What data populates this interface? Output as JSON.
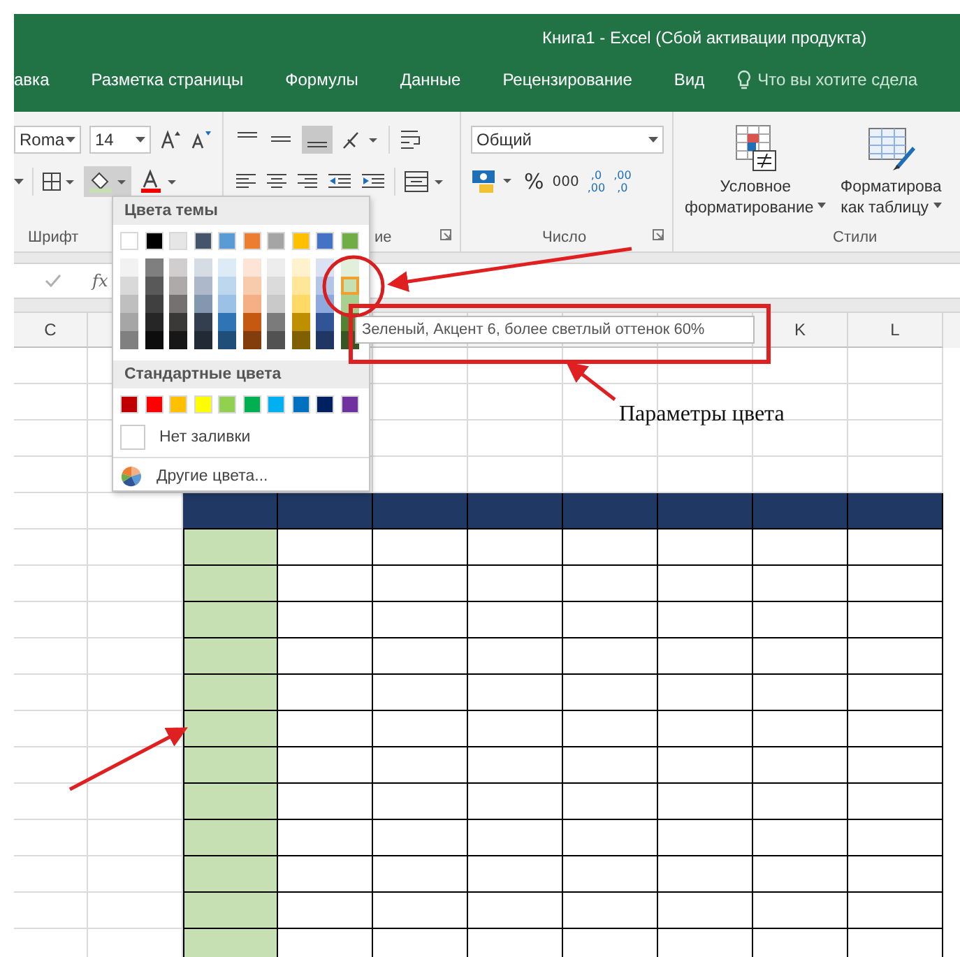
{
  "window": {
    "title": "Книга1 - Excel (Сбой активации продукта)"
  },
  "tabs": [
    {
      "label": "авка",
      "selected": false
    },
    {
      "label": "Разметка страницы",
      "selected": false
    },
    {
      "label": "Формулы",
      "selected": false
    },
    {
      "label": "Данные",
      "selected": false
    },
    {
      "label": "Рецензирование",
      "selected": false
    },
    {
      "label": "Вид",
      "selected": false
    }
  ],
  "tell_me": {
    "placeholder": "Что вы хотите сдела"
  },
  "ribbon": {
    "font_name": "Roma",
    "font_size": "14",
    "number_format": "Общий",
    "percent": "%",
    "thousands": "000",
    "increase_decimal": {
      "top": ",0",
      "bottom": ",00"
    },
    "decrease_decimal": {
      "top": ",00",
      "bottom": ",0"
    },
    "conditional_formatting": [
      "Условное",
      "форматирование"
    ],
    "format_as_table": [
      "Форматирова",
      "как таблицу"
    ],
    "group_labels": [
      "Шрифт",
      "ие",
      "Число",
      "Стили"
    ]
  },
  "formula_bar": {
    "fx": "fx"
  },
  "column_headers": [
    "C",
    "K",
    "L"
  ],
  "color_menu": {
    "theme_title": "Цвета темы",
    "theme_colors": [
      {
        "color": "#ffffff",
        "shades": [
          {
            "color": "#f2f2f2",
            "selected": false
          },
          {
            "color": "#d9d9d9",
            "selected": false
          },
          {
            "color": "#bfbfbf",
            "selected": false
          },
          {
            "color": "#a6a6a6",
            "selected": false
          },
          {
            "color": "#808080",
            "selected": false
          }
        ]
      },
      {
        "color": "#000000",
        "shades": [
          {
            "color": "#7f7f7f",
            "selected": false
          },
          {
            "color": "#595959",
            "selected": false
          },
          {
            "color": "#404040",
            "selected": false
          },
          {
            "color": "#262626",
            "selected": false
          },
          {
            "color": "#0d0d0d",
            "selected": false
          }
        ]
      },
      {
        "color": "#e7e6e6",
        "shades": [
          {
            "color": "#d0cece",
            "selected": false
          },
          {
            "color": "#aeaaaa",
            "selected": false
          },
          {
            "color": "#767171",
            "selected": false
          },
          {
            "color": "#3b3838",
            "selected": false
          },
          {
            "color": "#181717",
            "selected": false
          }
        ]
      },
      {
        "color": "#44546a",
        "shades": [
          {
            "color": "#d6dce4",
            "selected": false
          },
          {
            "color": "#adb9ca",
            "selected": false
          },
          {
            "color": "#8497b0",
            "selected": false
          },
          {
            "color": "#333f4f",
            "selected": false
          },
          {
            "color": "#222a35",
            "selected": false
          }
        ]
      },
      {
        "color": "#5b9bd5",
        "shades": [
          {
            "color": "#ddebf7",
            "selected": false
          },
          {
            "color": "#bdd7ee",
            "selected": false
          },
          {
            "color": "#9bc2e6",
            "selected": false
          },
          {
            "color": "#2f75b5",
            "selected": false
          },
          {
            "color": "#1f4e78",
            "selected": false
          }
        ]
      },
      {
        "color": "#ed7d31",
        "shades": [
          {
            "color": "#fce4d6",
            "selected": false
          },
          {
            "color": "#f8cbad",
            "selected": false
          },
          {
            "color": "#f4b084",
            "selected": false
          },
          {
            "color": "#c65911",
            "selected": false
          },
          {
            "color": "#833c0c",
            "selected": false
          }
        ]
      },
      {
        "color": "#a5a5a5",
        "shades": [
          {
            "color": "#ededed",
            "selected": false
          },
          {
            "color": "#dbdbdb",
            "selected": false
          },
          {
            "color": "#c9c9c9",
            "selected": false
          },
          {
            "color": "#7b7b7b",
            "selected": false
          },
          {
            "color": "#525252",
            "selected": false
          }
        ]
      },
      {
        "color": "#ffc000",
        "shades": [
          {
            "color": "#fff2cc",
            "selected": false
          },
          {
            "color": "#ffe699",
            "selected": false
          },
          {
            "color": "#ffd966",
            "selected": false
          },
          {
            "color": "#bf8f00",
            "selected": false
          },
          {
            "color": "#806000",
            "selected": false
          }
        ]
      },
      {
        "color": "#4472c4",
        "shades": [
          {
            "color": "#d9e1f2",
            "selected": false
          },
          {
            "color": "#b4c6e7",
            "selected": false
          },
          {
            "color": "#8ea9db",
            "selected": false
          },
          {
            "color": "#305496",
            "selected": false
          },
          {
            "color": "#203764",
            "selected": false
          }
        ]
      },
      {
        "color": "#70ad47",
        "shades": [
          {
            "color": "#e2efda",
            "selected": false
          },
          {
            "color": "#c6e0b4",
            "selected": true
          },
          {
            "color": "#a9d08e",
            "selected": false
          },
          {
            "color": "#548235",
            "selected": false
          },
          {
            "color": "#375623",
            "selected": false
          }
        ]
      }
    ],
    "standard_title": "Стандартные цвета",
    "standard_colors": [
      {
        "color": "#c00000"
      },
      {
        "color": "#ff0000"
      },
      {
        "color": "#ffc000"
      },
      {
        "color": "#ffff00"
      },
      {
        "color": "#92d050"
      },
      {
        "color": "#00b050"
      },
      {
        "color": "#00b0f0"
      },
      {
        "color": "#0070c0"
      },
      {
        "color": "#002060"
      },
      {
        "color": "#7030a0"
      }
    ],
    "no_fill": "Нет заливки",
    "more_colors": "Другие цвета..."
  },
  "tooltip": "Зеленый, Акцент 6, более светлый оттенок 60%",
  "annotation": "Параметры цвета"
}
